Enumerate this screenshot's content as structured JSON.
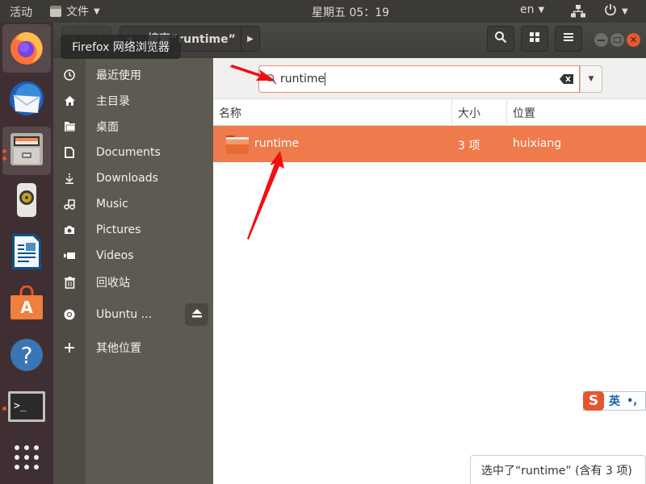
{
  "topbar": {
    "activities": "活动",
    "app_menu": "文件",
    "clock": "星期五 05：19",
    "input_method": "en"
  },
  "dock": {
    "items": [
      {
        "name": "firefox",
        "label": "Firefox 网络浏览器"
      },
      {
        "name": "thunderbird"
      },
      {
        "name": "files"
      },
      {
        "name": "rhythmbox"
      },
      {
        "name": "libreoffice-writer"
      },
      {
        "name": "ubuntu-software"
      },
      {
        "name": "help"
      },
      {
        "name": "terminal"
      },
      {
        "name": "show-applications"
      }
    ],
    "tooltip": "Firefox 网络浏览器"
  },
  "header": {
    "location": "搜索“runtime”"
  },
  "sidebar": {
    "items": [
      {
        "label": "最近使用",
        "icon": "clock-icon"
      },
      {
        "label": "主目录",
        "icon": "home-icon"
      },
      {
        "label": "桌面",
        "icon": "folder-icon"
      },
      {
        "label": "Documents",
        "icon": "document-icon"
      },
      {
        "label": "Downloads",
        "icon": "download-icon"
      },
      {
        "label": "Music",
        "icon": "music-icon"
      },
      {
        "label": "Pictures",
        "icon": "camera-icon"
      },
      {
        "label": "Videos",
        "icon": "video-icon"
      },
      {
        "label": "回收站",
        "icon": "trash-icon"
      },
      {
        "label": "Ubuntu ...",
        "icon": "disc-icon"
      },
      {
        "label": "其他位置",
        "icon": "plus-icon"
      }
    ]
  },
  "search": {
    "value": "runtime"
  },
  "columns": {
    "name": "名称",
    "size": "大小",
    "location": "位置"
  },
  "results": [
    {
      "name": "runtime",
      "size": "3 项",
      "location": "huixiang",
      "selected": true
    }
  ],
  "status": "选中了“runtime” (含有 3 项)",
  "ime": {
    "label": "英",
    "punct": "•,"
  },
  "colors": {
    "accent": "#e95420",
    "selection": "#ef7a4b",
    "sidebar": "#5d5b51"
  }
}
